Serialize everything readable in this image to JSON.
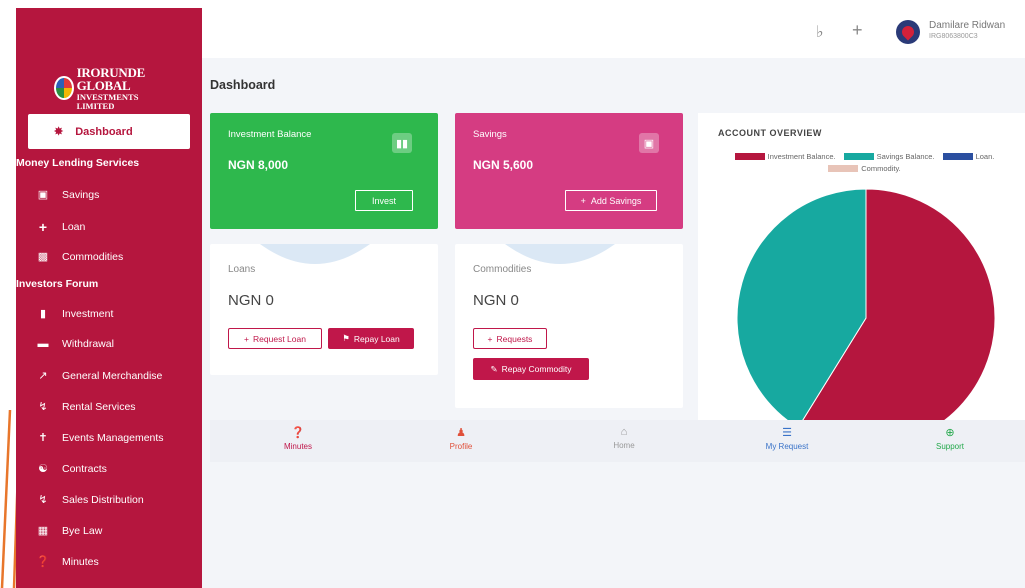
{
  "sidebar": {
    "logo_line1": "IRORUNDE GLOBAL",
    "logo_line2": "INVESTMENTS LIMITED",
    "active_item": "Dashboard",
    "section_money": "Money Lending Services",
    "section_investors": "Investors Forum",
    "items": [
      {
        "label": "Savings",
        "icon": "money-icon"
      },
      {
        "label": "Loan",
        "icon": "plus-icon"
      },
      {
        "label": "Commodities",
        "icon": "shopping-bag-icon"
      },
      {
        "label": "Investment",
        "icon": "bar-chart-icon"
      },
      {
        "label": "Withdrawal",
        "icon": "credit-card-icon"
      },
      {
        "label": "General Merchandise",
        "icon": "cart-icon"
      },
      {
        "label": "Rental Services",
        "icon": "cart-down-icon"
      },
      {
        "label": "Events Managements",
        "icon": "trophy-icon"
      },
      {
        "label": "Contracts",
        "icon": "handshake-icon"
      },
      {
        "label": "Sales Distribution",
        "icon": "cart-icon"
      },
      {
        "label": "Bye Law",
        "icon": "id-card-icon"
      },
      {
        "label": "Minutes",
        "icon": "question-icon"
      }
    ]
  },
  "header": {
    "user_name": "Damilare Ridwan",
    "user_id": "IRG8063800C3"
  },
  "page_title": "Dashboard",
  "cards": {
    "investment": {
      "label": "Investment Balance",
      "value": "NGN 8,000",
      "button": "Invest"
    },
    "savings": {
      "label": "Savings",
      "value": "NGN 5,600",
      "button": "Add Savings"
    },
    "loans": {
      "label": "Loans",
      "value": "NGN 0",
      "btn_request": "Request Loan",
      "btn_repay": "Repay Loan"
    },
    "commodities": {
      "label": "Commodities",
      "value": "NGN 0",
      "btn_request": "Requests",
      "btn_repay": "Repay Commodity"
    }
  },
  "chart_data": {
    "type": "pie",
    "title": "ACCOUNT OVERVIEW",
    "categories": [
      "Investment Balance.",
      "Savings Balance.",
      "Loan.",
      "Commodity."
    ],
    "values": [
      8000,
      5600,
      0,
      0
    ],
    "colors": [
      "#b5163e",
      "#17a9a0",
      "#2b4fa0",
      "#e8c4b8"
    ],
    "legend_position": "top"
  },
  "bottom_nav": [
    {
      "label": "Minutes",
      "icon": "question-icon",
      "color": "#c0174a"
    },
    {
      "label": "Profile",
      "icon": "user-plus-icon",
      "color": "#e0503a"
    },
    {
      "label": "Home",
      "icon": "home-icon",
      "color": "#999999"
    },
    {
      "label": "My Request",
      "icon": "list-icon",
      "color": "#3a73c8"
    },
    {
      "label": "Support",
      "icon": "lifebuoy-icon",
      "color": "#22a84a"
    }
  ]
}
